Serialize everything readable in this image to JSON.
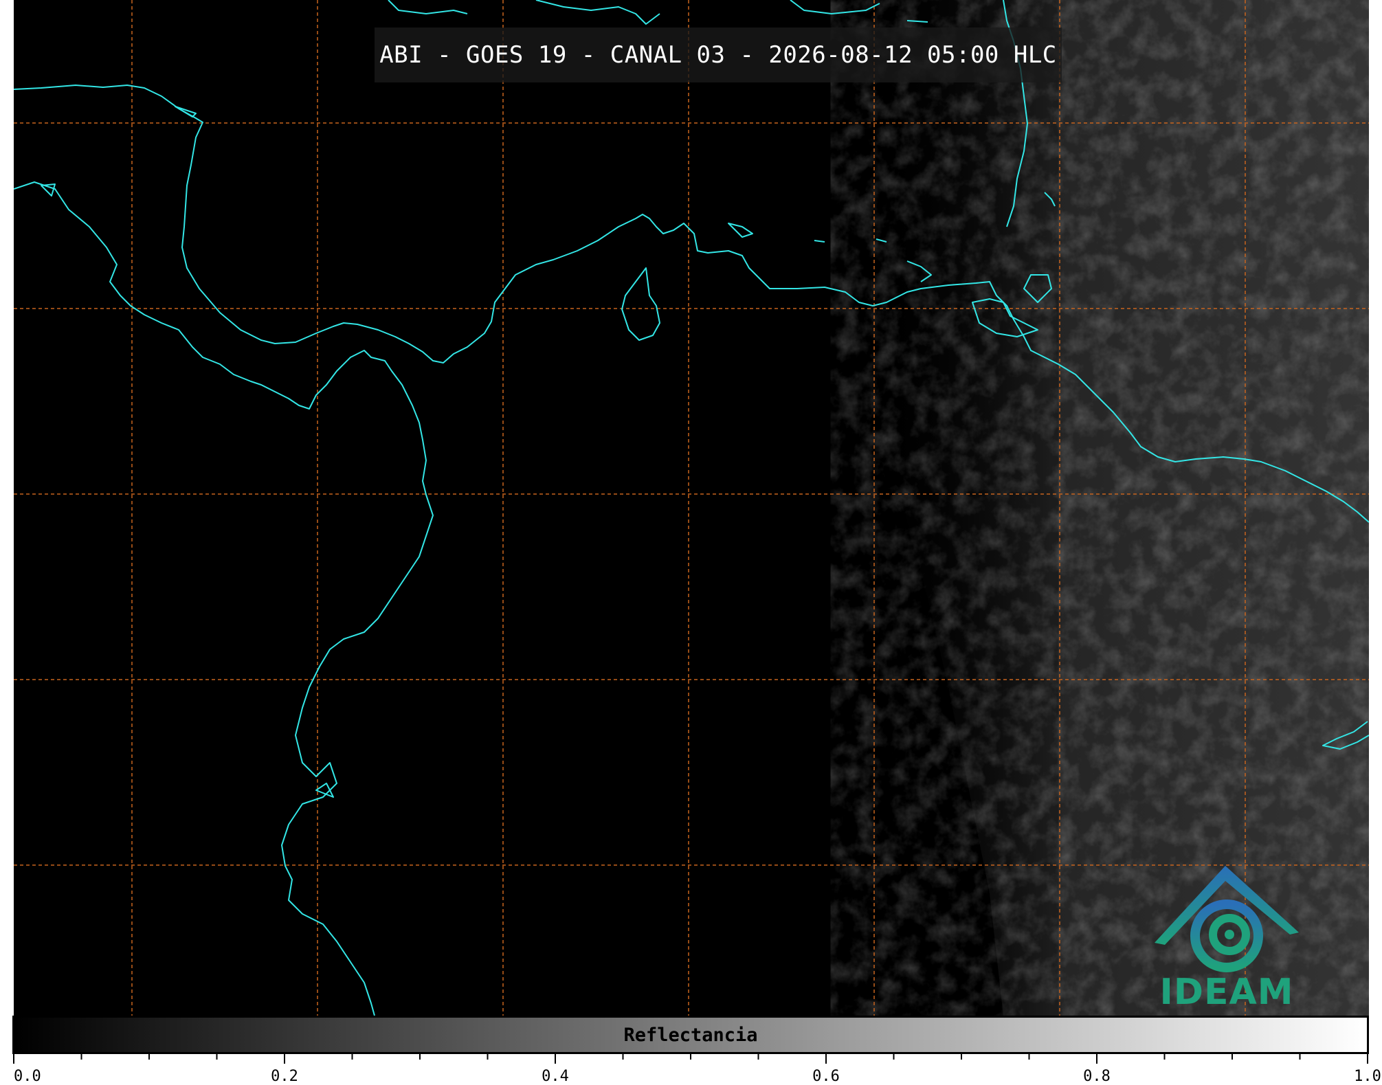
{
  "title": "ABI - GOES 19 - CANAL 03 - 2026-08-12 05:00 HLC",
  "colorbar": {
    "label": "Reflectancia",
    "ticks": [
      "0.0",
      "0.2",
      "0.4",
      "0.6",
      "0.8",
      "1.0"
    ],
    "range": [
      0.0,
      1.0
    ],
    "colormap": "greyscale"
  },
  "logo": {
    "text": "IDEAM"
  },
  "colors": {
    "background": "#000000",
    "coastline": "#33e6e6",
    "gridlines": "#c8641e",
    "logo_blue": "#2a7fb8",
    "logo_green": "#1fa27c"
  },
  "map": {
    "gridlines": "dashed",
    "coastlines": true
  }
}
